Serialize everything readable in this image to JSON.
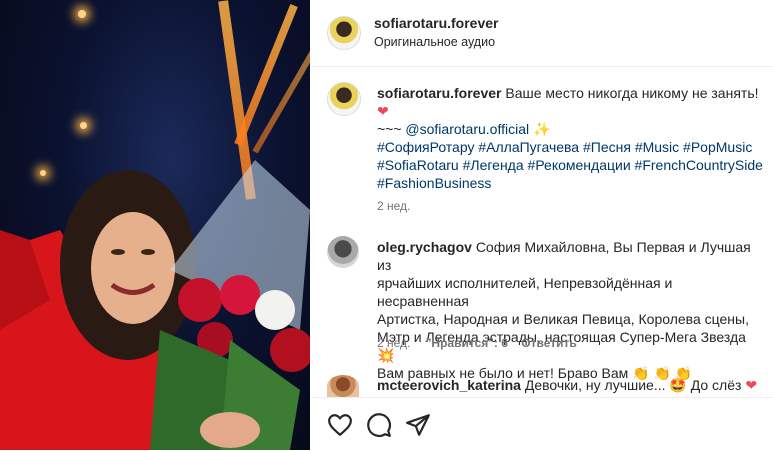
{
  "post": {
    "username": "sofiarotaru.forever",
    "audio": "Оригинальное аудио"
  },
  "caption": {
    "username": "sofiarotaru.forever",
    "text": "Ваше место никогда никому не занять!",
    "line2_prefix": "~~~",
    "mention": "@sofiarotaru.official",
    "hashtags_line1": "#СофияРотару #АллаПугачева #Песня #Music #PopMusic",
    "hashtags_line2": "#SofiaRotaru #Легенда #Рекомендации #FrenchCountrySide",
    "hashtags_line3": "#FashionBusiness",
    "time": "2 нед."
  },
  "comments": [
    {
      "username": "oleg.rychagov",
      "text_line1": "София Михайловна, Вы Первая и Лучшая из",
      "text_line2": "ярчайших исполнителей, Непревзойдённая и несравненная",
      "text_line3": "Артистка, Народная и Великая Певица, Королева сцены,",
      "text_line4": "Мэтр и Легенда эстрады, настоящая Супер-Мега Звезда",
      "text_line5": "Вам равных не было и нет! Браво Вам",
      "time": "2 нед.",
      "likes": "\"Нравится\": 6",
      "reply": "Ответить"
    },
    {
      "username": "mcteerovich_katerina",
      "text": "Девочки, ну лучшие...",
      "text_end": "До слёз"
    }
  ],
  "icons": [
    "heart-icon",
    "comment-icon",
    "share-icon"
  ],
  "colors": {
    "link": "#00376b",
    "meta": "#737373",
    "heart": "#ed4956"
  }
}
